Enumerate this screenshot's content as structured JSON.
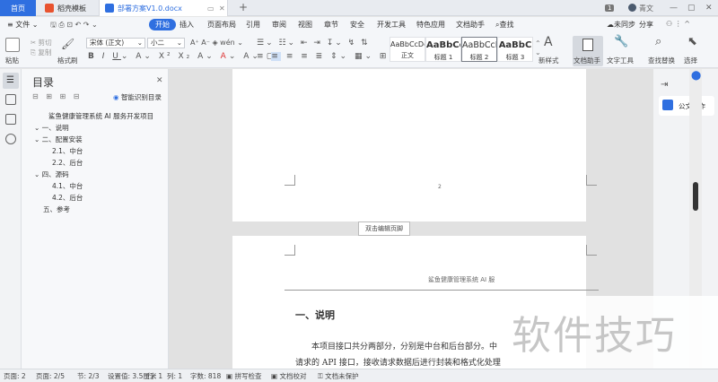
{
  "tabs": {
    "home": "首页",
    "store": "稻壳模板",
    "doc": "部署方案V1.0.docx",
    "page_badge": "1",
    "user": "青文"
  },
  "menu": {
    "file": "文件",
    "items": [
      "开始",
      "插入",
      "页面布局",
      "引用",
      "审阅",
      "视图",
      "章节",
      "安全",
      "开发工具",
      "特色应用",
      "文档助手"
    ],
    "search": "查找",
    "sync": "未同步",
    "share": "分享"
  },
  "ribbon": {
    "paste": "粘贴",
    "cut": "剪切",
    "copy": "复制",
    "format_painter": "格式刷",
    "font_name": "宋体 (正文)",
    "font_size": "小二",
    "styles": [
      {
        "preview": "AaBbCcDd",
        "name": "正文"
      },
      {
        "preview": "AaBbCc",
        "name": "标题 1"
      },
      {
        "preview": "AaBbCcI",
        "name": "标题 2"
      },
      {
        "preview": "AaBbC",
        "name": "标题 3"
      }
    ],
    "new_style": "新样式",
    "doc_assistant": "文档助手",
    "text_tools": "文字工具",
    "find_replace": "查找替换",
    "select": "选择"
  },
  "toc": {
    "title": "目录",
    "smart_toc": "智能识别目录",
    "items": [
      "鲨鱼健康管理系统 AI 服务开发项目",
      "一、说明",
      "二、配置安装",
      "2.1、中台",
      "2.2、后台",
      "四、源码",
      "4.1、中台",
      "4.2、后台",
      "五、参考"
    ]
  },
  "doc": {
    "page_number": "2",
    "edit_header_tip": "双击编辑页脚",
    "header_text": "鲨鱼健康管理系统 AI 服",
    "heading": "一、说明",
    "para_line1": "本项目接口共分两部分，分别是中台和后台部分。中",
    "para_line2": "请求的 API 接口，接收请求数据后进行封装和格式化处理"
  },
  "right_panel": {
    "write": "公文写作"
  },
  "status": {
    "page": "页面: 2",
    "pages": "页面: 2/5",
    "section": "节: 2/3",
    "setting": "设置值: 3.5厘米",
    "row": "行: 1",
    "col": "列: 1",
    "words": "字数: 818",
    "spell": "拼写检查",
    "proof": "文档校对",
    "protect": "文档未保护"
  },
  "watermark": "软件技巧",
  "colors": {
    "accent": "#2f6fe0",
    "home_tab": "#2f6fe0"
  }
}
